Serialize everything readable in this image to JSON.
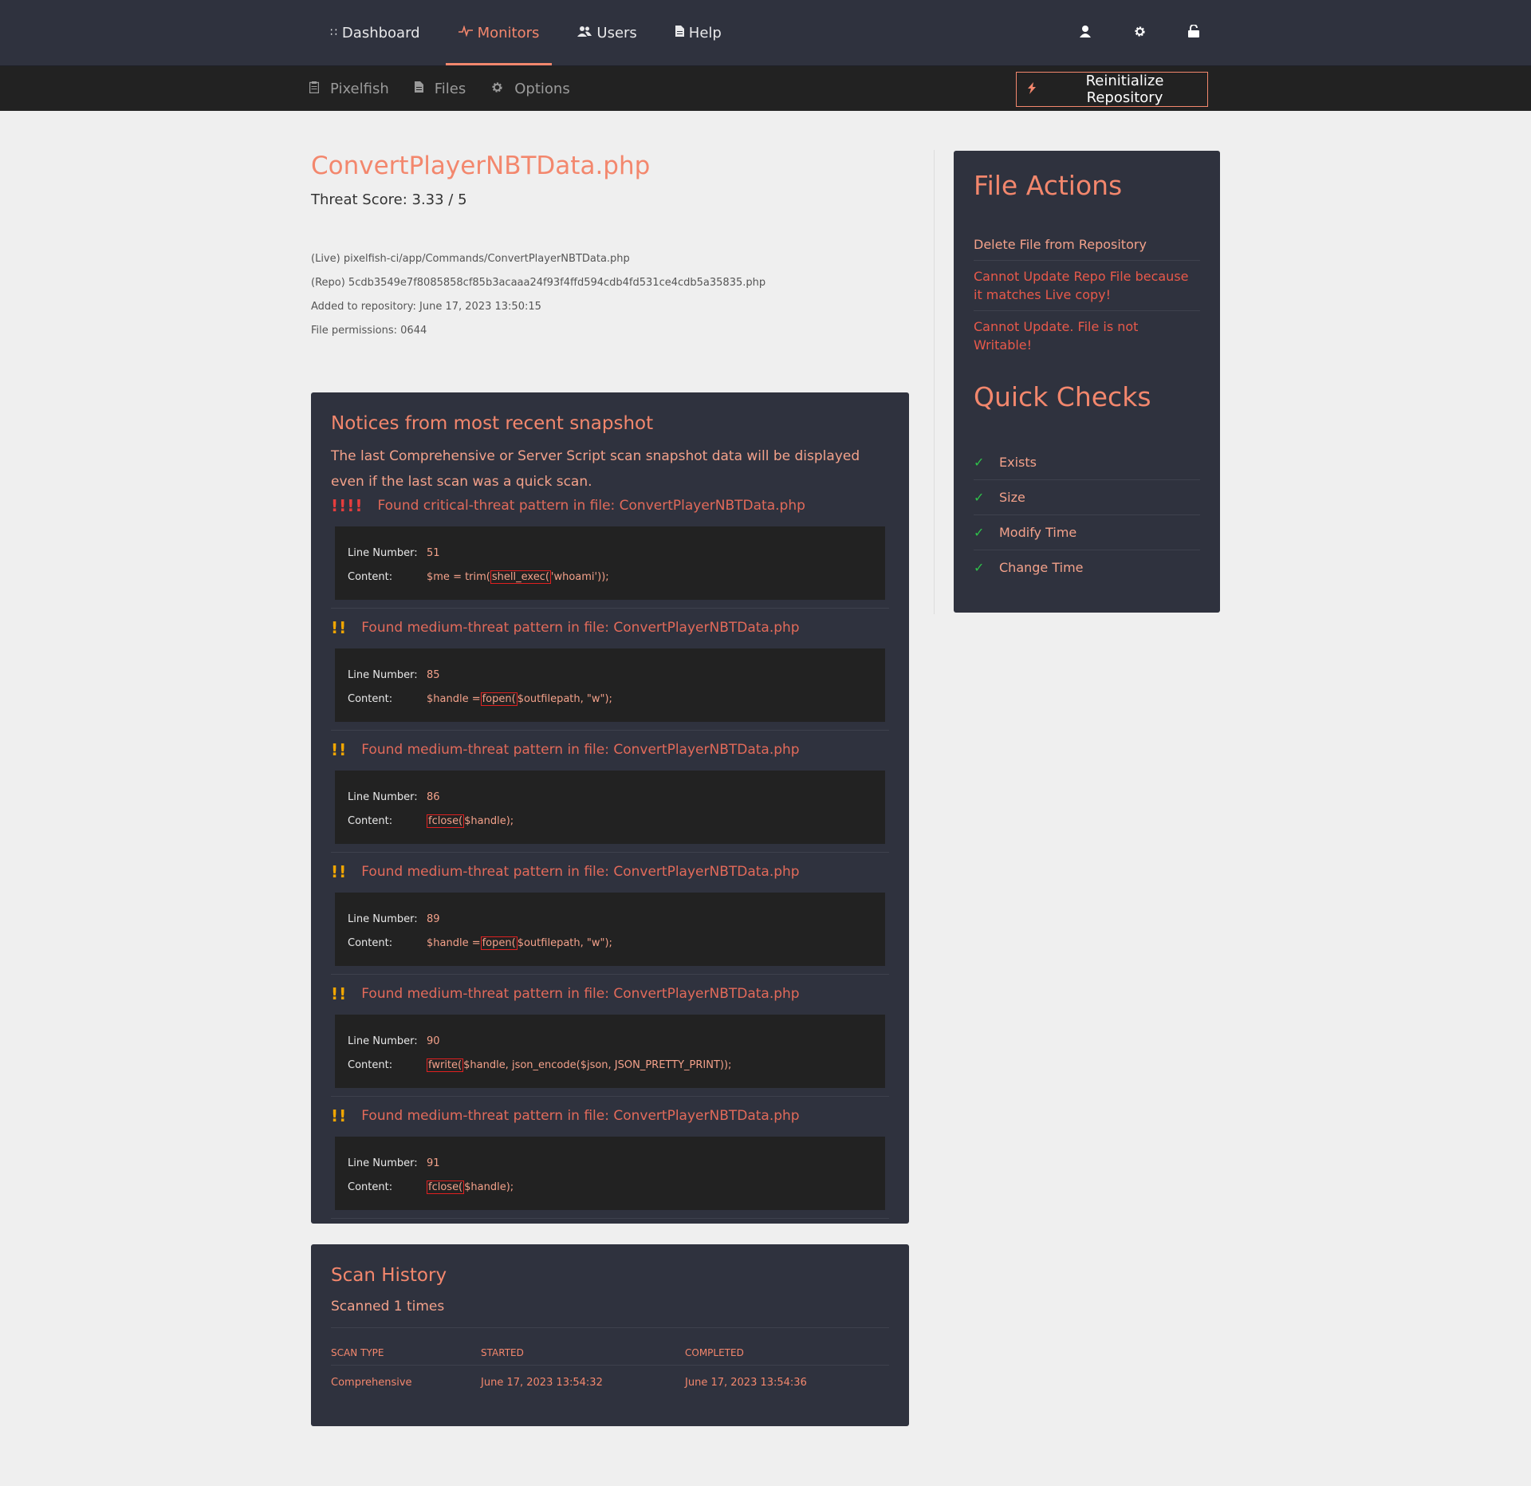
{
  "nav": {
    "items": [
      {
        "label": "Dashboard",
        "icon": "grid-icon",
        "active": false
      },
      {
        "label": "Monitors",
        "icon": "pulse-icon",
        "active": true
      },
      {
        "label": "Users",
        "icon": "users-icon",
        "active": false
      },
      {
        "label": "Help",
        "icon": "document-icon",
        "active": false
      }
    ],
    "right_icons": [
      "user-icon",
      "gear-icon",
      "unlock-icon"
    ]
  },
  "subnav": {
    "items": [
      {
        "label": "Pixelfish",
        "icon": "clipboard-icon"
      },
      {
        "label": "Files",
        "icon": "file-icon"
      },
      {
        "label": "Options",
        "icon": "cog-icon"
      }
    ],
    "reinit_label": "Reinitialize Repository"
  },
  "file": {
    "name": "ConvertPlayerNBTData.php",
    "threat_score": "Threat Score: 3.33 / 5",
    "live_path": "(Live) pixelfish-ci/app/Commands/ConvertPlayerNBTData.php",
    "repo_path": "(Repo) 5cdb3549e7f8085858cf85b3acaaa24f93f4ffd594cdb4fd531ce4cdb5a35835.php",
    "added": "Added to repository: June 17, 2023 13:50:15",
    "permissions": "File permissions: 0644"
  },
  "notices": {
    "title": "Notices from most recent snapshot",
    "description": "The last Comprehensive or Server Script scan snapshot data will be displayed even if the last scan was a quick scan.",
    "line_label": "Line Number:",
    "content_label": "Content:",
    "findings": [
      {
        "level": "critical",
        "bangs": "!!!!",
        "message": "Found critical-threat pattern in file: ConvertPlayerNBTData.php",
        "line": "51",
        "pre": "$me = trim(",
        "hl": "shell_exec(",
        "post": "'whoami'));"
      },
      {
        "level": "medium",
        "bangs": "!!",
        "message": "Found medium-threat pattern in file: ConvertPlayerNBTData.php",
        "line": "85",
        "pre": "$handle =",
        "hl": "fopen(",
        "post": "$outfilepath, \"w\");"
      },
      {
        "level": "medium",
        "bangs": "!!",
        "message": "Found medium-threat pattern in file: ConvertPlayerNBTData.php",
        "line": "86",
        "pre": "",
        "hl": "fclose(",
        "post": "$handle);"
      },
      {
        "level": "medium",
        "bangs": "!!",
        "message": "Found medium-threat pattern in file: ConvertPlayerNBTData.php",
        "line": "89",
        "pre": "$handle =",
        "hl": "fopen(",
        "post": "$outfilepath, \"w\");"
      },
      {
        "level": "medium",
        "bangs": "!!",
        "message": "Found medium-threat pattern in file: ConvertPlayerNBTData.php",
        "line": "90",
        "pre": "",
        "hl": "fwrite(",
        "post": "$handle, json_encode($json, JSON_PRETTY_PRINT));"
      },
      {
        "level": "medium",
        "bangs": "!!",
        "message": "Found medium-threat pattern in file: ConvertPlayerNBTData.php",
        "line": "91",
        "pre": "",
        "hl": "fclose(",
        "post": "$handle);"
      }
    ]
  },
  "history": {
    "title": "Scan History",
    "scanned": "Scanned 1 times",
    "columns": [
      "SCAN TYPE",
      "STARTED",
      "COMPLETED"
    ],
    "rows": [
      [
        "Comprehensive",
        "June 17, 2023 13:54:32",
        "June 17, 2023 13:54:36"
      ]
    ]
  },
  "sidebar": {
    "actions_title": "File Actions",
    "actions": [
      {
        "label": "Delete File from Repository",
        "kind": "ok"
      },
      {
        "label": "Cannot Update Repo File because it matches Live copy!",
        "kind": "err"
      },
      {
        "label": "Cannot Update. File is not Writable!",
        "kind": "err"
      }
    ],
    "checks_title": "Quick Checks",
    "checks": [
      "Exists",
      "Size",
      "Modify Time",
      "Change Time"
    ]
  },
  "colors": {
    "accent": "#f3876d",
    "nav_bg": "#2f323e",
    "subnav_bg": "#222222",
    "critical": "#e53d3d",
    "medium": "#f0a500",
    "check": "#2ec04a"
  }
}
